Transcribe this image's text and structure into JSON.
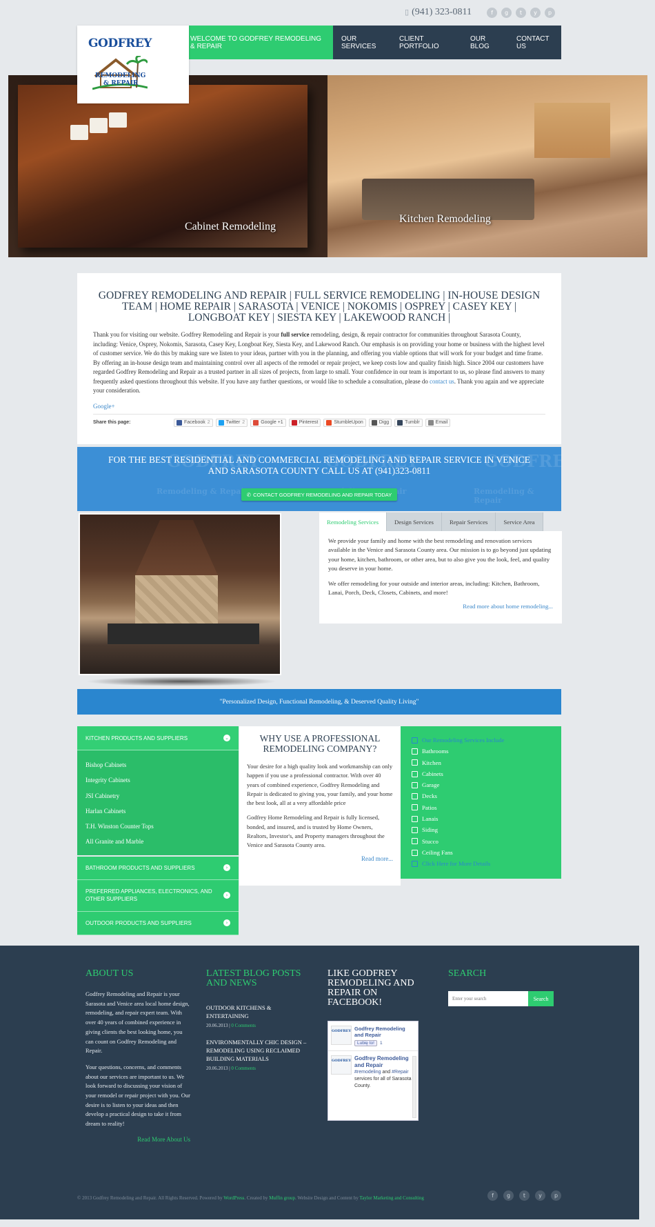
{
  "header": {
    "phone": "(941) 323-0811",
    "phone_icon": "phone-icon",
    "social": [
      "facebook-icon",
      "google-plus-icon",
      "twitter-icon",
      "youtube-icon",
      "pinterest-icon"
    ],
    "social_glyphs": [
      "f",
      "g",
      "t",
      "y",
      "p"
    ]
  },
  "logo": {
    "name": "GODFREY",
    "sub1": "REMODELING",
    "sub2": "& REPAIR"
  },
  "nav": [
    "WELCOME TO GODFREY REMODELING & REPAIR",
    "OUR SERVICES",
    "CLIENT PORTFOLIO",
    "OUR BLOG",
    "CONTACT US"
  ],
  "hero": {
    "left_caption": "Cabinet Remodeling",
    "right_caption": "Kitchen Remodeling"
  },
  "intro": {
    "title": "GODFREY REMODELING AND REPAIR | FULL SERVICE REMODELING | IN-HOUSE DESIGN TEAM | HOME REPAIR | SARASOTA | VENICE | NOKOMIS | OSPREY | CASEY KEY | LONGBOAT KEY | SIESTA KEY | LAKEWOOD RANCH |",
    "p_a": "Thank you for visiting our website. Godfrey Remodeling and Repair is your ",
    "p_bold": "full service",
    "p_b": " remodeling, design, & repair contractor for communities throughout Sarasota County, including: Venice, Osprey, Nokomis, Sarasota, Casey Key, Longboat Key, Siesta Key, and Lakewood Ranch. Our emphasis is on providing your home or business with the highest level of customer service. We do this by making sure we listen to your ideas, partner with you in the planning, and offering you viable options that will work for your budget and time frame. By offering an in-house design team and maintaining control over all aspects of the remodel or repair project, we keep costs low and quality finish high. Since 2004 our customers have regarded Godfrey Remodeling and Repair as a trusted partner in all sizes of projects, from large to small.  Your confidence in our team is important to us, so please find answers to many frequently asked questions throughout this website. If you have any further questions, or would like to schedule a consultation, please do ",
    "p_link": "contact us",
    "p_c": ". Thank you again and we appreciate your consideration.",
    "gplus": "Google+",
    "share_label": "Share this page:",
    "share_buttons": [
      {
        "label": "Facebook",
        "count": "2",
        "color": "#3b5998"
      },
      {
        "label": "Twitter",
        "count": "2",
        "color": "#1da1f2"
      },
      {
        "label": "Google +1",
        "count": "",
        "color": "#dd4b39"
      },
      {
        "label": "Pinterest",
        "count": "",
        "color": "#cb2027"
      },
      {
        "label": "StumbleUpon",
        "count": "",
        "color": "#eb4924"
      },
      {
        "label": "Digg",
        "count": "",
        "color": "#555555"
      },
      {
        "label": "Tumblr",
        "count": "",
        "color": "#35465c"
      },
      {
        "label": "Email",
        "count": "",
        "color": "#888888"
      }
    ]
  },
  "cta": {
    "text": "FOR THE BEST RESIDENTIAL AND COMMERCIAL REMODELING AND REPAIR SERVICE IN VENICE AND SARASOTA COUNTY CALL US AT (941)323-0811",
    "button": "CONTACT GODFREY REMODELING AND REPAIR TODAY",
    "watermark": "GODFREY",
    "watermark_sub": "Remodeling & Repair"
  },
  "tabs": {
    "labels": [
      "Remodeling Services",
      "Design Services",
      "Repair Services",
      "Service Area"
    ],
    "p1": "We provide your family and home with the best remodeling and renovation services available in the Venice and Sarasota County area. Our mission is to go beyond just updating your home, kitchen, bathroom, or other area, but to also give you the look, feel, and quality you deserve in your home.",
    "p2": "We offer remodeling for your outside and interior areas, including: Kitchen, Bathroom, Lanai, Porch, Deck, Closets, Cabinets, and more!",
    "more": "Read more about home remodeling..."
  },
  "quote": "\"Personalized Design, Functional Remodeling, & Deserved Quality Living\"",
  "accordion": {
    "open_title": "KITCHEN PRODUCTS AND SUPPLIERS",
    "items": [
      "Bishop Cabinets",
      "Integrity Cabinets",
      "JSI Cabinetry",
      "Harlan Cabinets",
      "T.H. Winston Counter Tops",
      "All Granite and Marble"
    ],
    "closed": [
      "BATHROOM PRODUCTS AND SUPPLIERS",
      "PREFERRED APPLIANCES, ELECTRONICS, AND OTHER SUPPLIERS",
      "OUTDOOR PRODUCTS AND SUPPLIERS"
    ]
  },
  "why": {
    "title": "WHY USE A PROFESSIONAL REMODELING COMPANY?",
    "p1": "Your desire for a high quality look and workmanship can only happen if you use a professional contractor. With over 40 years of combined experience, Godfrey Remodeling and Repair is dedicated to giving you, your family, and your home the best look, all at a very affordable price",
    "p2": "Godfrey Home Remodeling and Repair is fully licensed, bonded, and insured, and is trusted by Home Owners, Realtors, Investor's, and Property managers throughout the Venice and Sarasota County area.",
    "more": "Read more..."
  },
  "services": {
    "heading": "Our Remodeling Services Include",
    "items": [
      "Bathrooms",
      "Kitchen",
      "Cabinets",
      "Garage",
      "Decks",
      "Patios",
      "Lanais",
      "Siding",
      "Stucco",
      "Ceiling Fans"
    ],
    "more": "Click Here for More Details"
  },
  "footer": {
    "about_title": "ABOUT US",
    "about_p1": "Godfrey Remodeling and Repair is your Sarasota and Venice area local home design, remodeling, and repair expert team. With over 40 years of combined experience in giving clients the best looking home, you can count on Godfrey Remodeling and Repair.",
    "about_p2": "Your questions, concerns, and comments about our services are important to us. We look forward to discussing your vision of your remodel or repair project with you. Our desire is to listen to your ideas and then develop a practical design to take it from dream to reality!",
    "about_more": "Read More About Us",
    "blog_title": "LATEST BLOG POSTS AND NEWS",
    "posts": [
      {
        "title": "OUTDOOR KITCHENS & ENTERTAINING",
        "date": "20.06.2013",
        "comments": "0 Comments"
      },
      {
        "title": "ENVIRONMENTALLY CHIC DESIGN – REMODELING USING RECLAIMED BUILDING MATERIALS",
        "date": "20.06.2013",
        "comments": "0 Comments"
      }
    ],
    "fb_title": "LIKE GODFREY REMODELING AND REPAIR ON FACEBOOK!",
    "fb_page": "Godfrey Remodeling and Repair",
    "fb_like": "Lubię to!",
    "fb_count": "1",
    "fb_post_name": "Godfrey Remodeling and Repair",
    "fb_post_tags": "#remodeling",
    "fb_post_and": "and",
    "fb_post_tag2": "#Repair",
    "fb_post_text": "services for all of Sarasota County.",
    "search_title": "SEARCH",
    "search_placeholder": "Enter your search",
    "search_button": "Search",
    "copyright_a": "© 2013 Godfrey Remodeling and Repair. All Rights Reserved. Powered by ",
    "copyright_wp": "WordPress",
    "copyright_b": ". Created by ",
    "copyright_muffin": "Muffin group",
    "copyright_c": ". Website Design and Content by ",
    "copyright_taylor": "Taylor Marketing and Consulting"
  },
  "colors": {
    "green": "#2ecc71",
    "navy": "#2c3e50",
    "blue": "#2a86cf"
  }
}
